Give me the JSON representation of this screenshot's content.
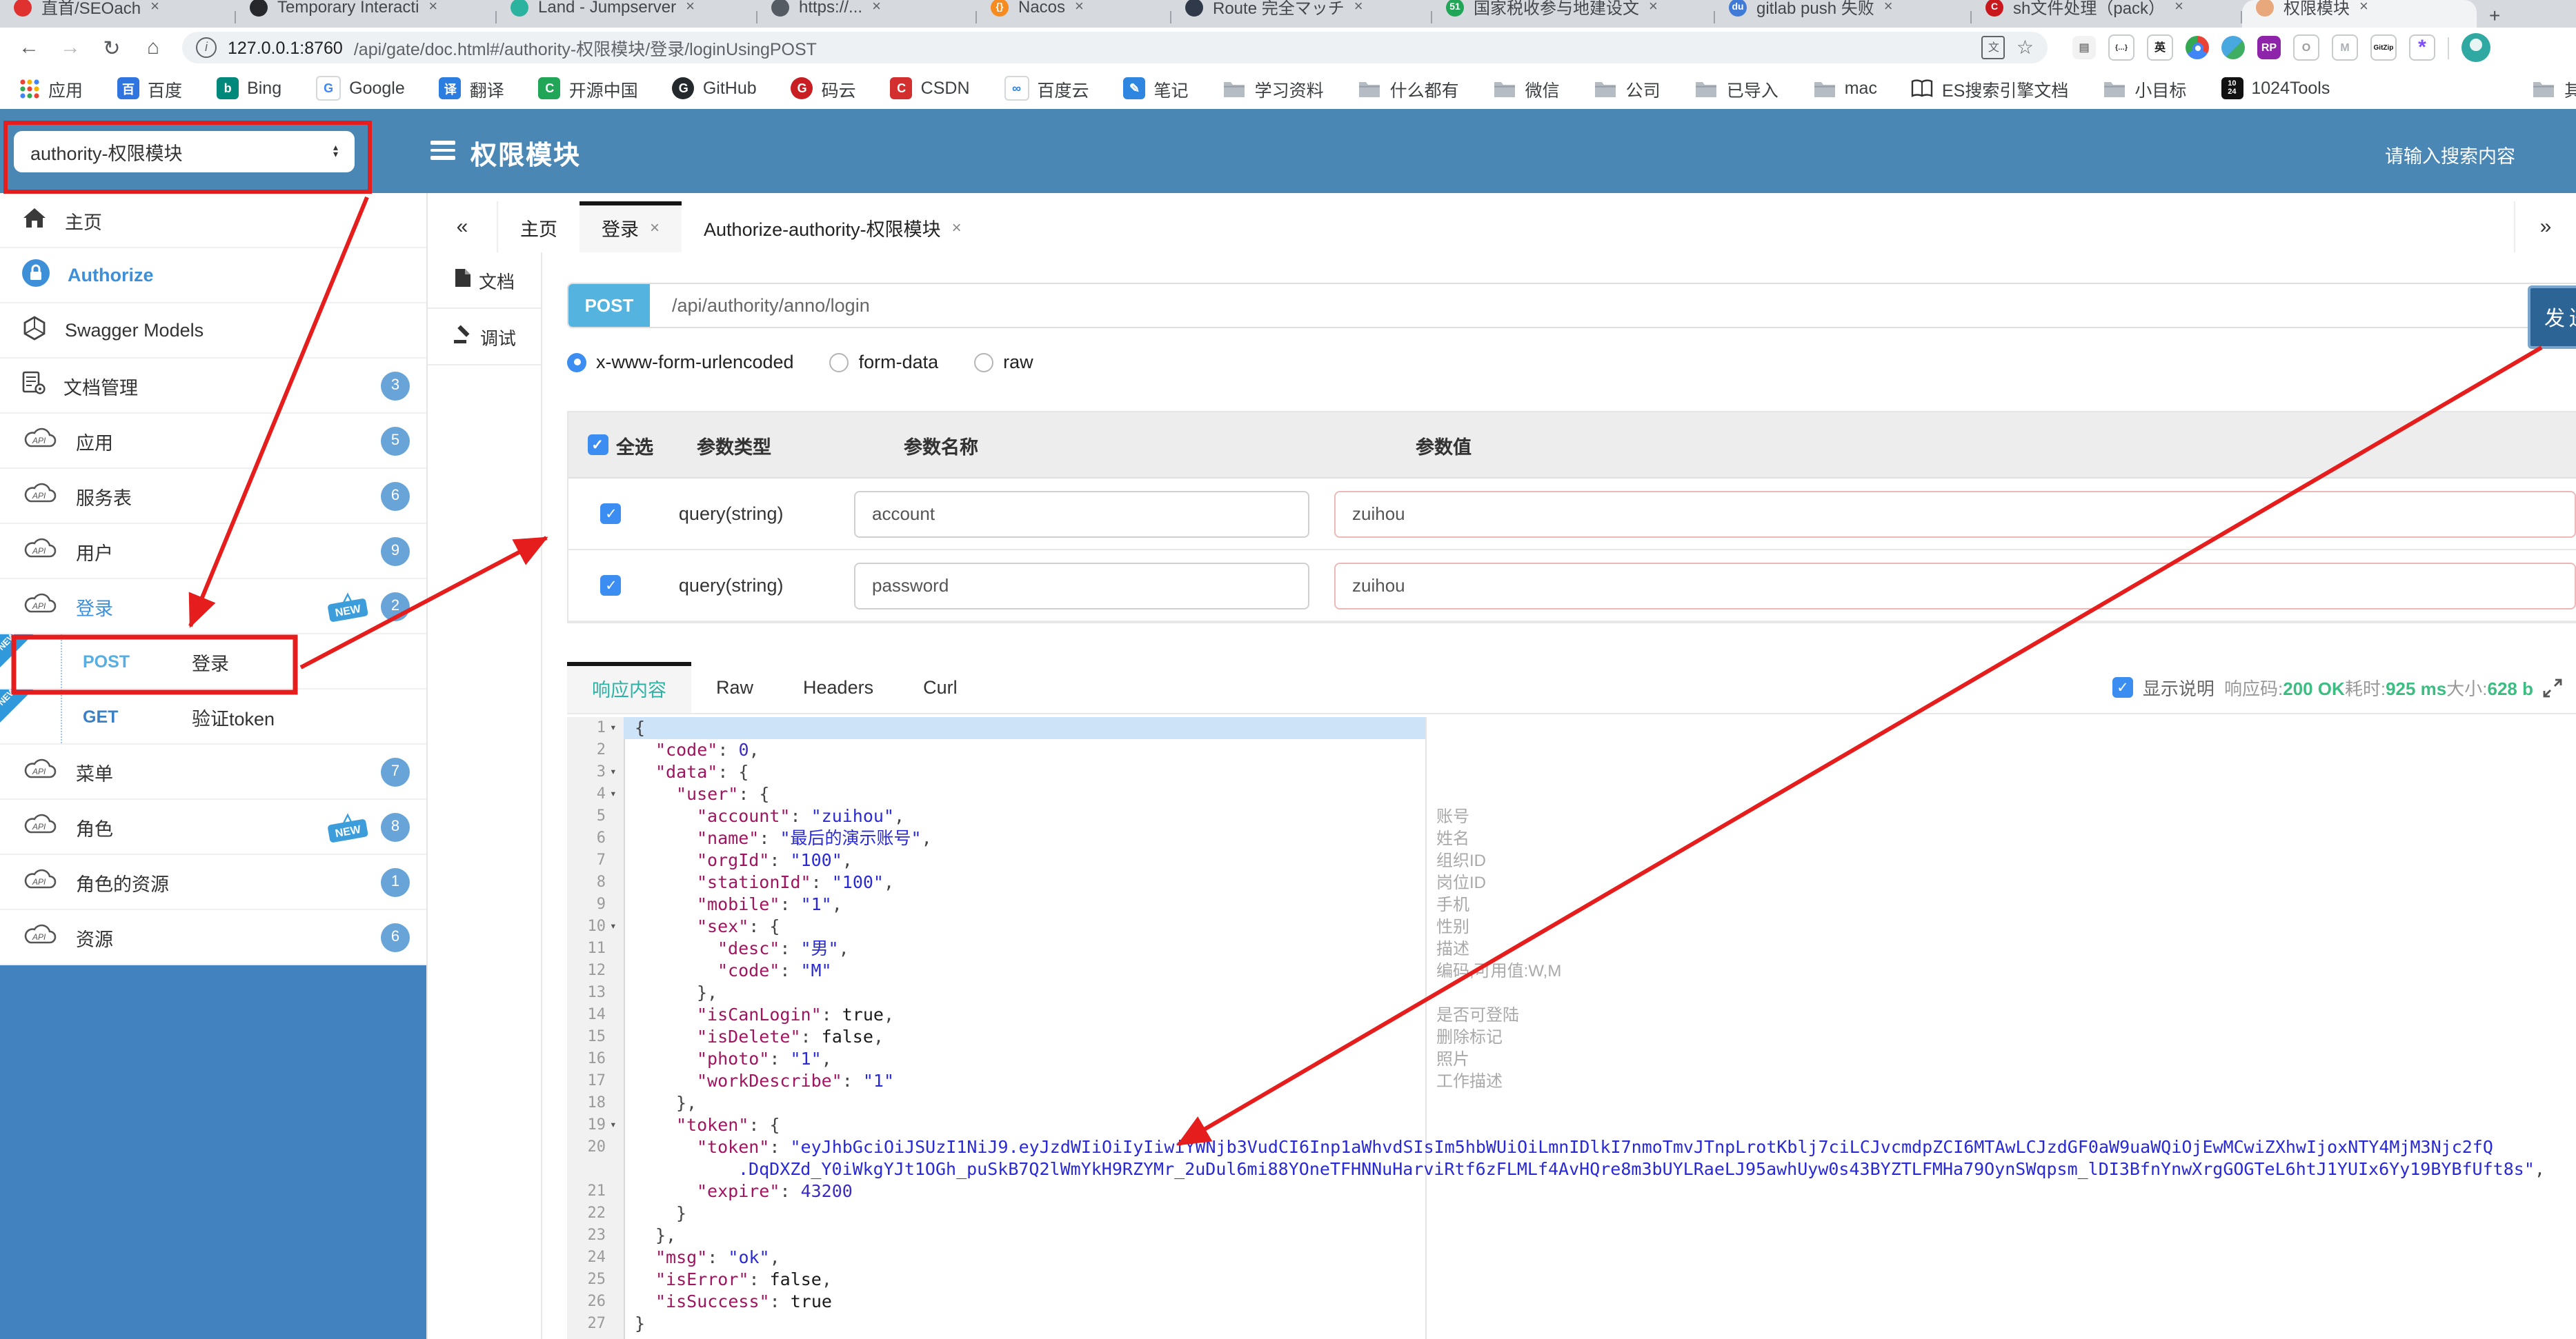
{
  "browser": {
    "tabs": [
      {
        "title": "直首/SEOach",
        "color": "#e03131",
        "glyph": "",
        "w": 150
      },
      {
        "title": "Temporary Interacti",
        "color": "#26282b",
        "glyph": "",
        "w": 168
      },
      {
        "title": "Land - Jumpserver",
        "color": "#2bb3a0",
        "glyph": "",
        "w": 168
      },
      {
        "title": "https://...",
        "color": "#555b63",
        "glyph": "",
        "w": 138
      },
      {
        "title": "Nacos",
        "color": "#f68b1f",
        "glyph": "{}",
        "w": 120
      },
      {
        "title": "Route 完全マッチ",
        "color": "#30394a",
        "glyph": "",
        "w": 168
      },
      {
        "title": "国家税收参与地建设文",
        "color": "#21a556",
        "glyph": "51",
        "w": 184
      },
      {
        "title": "gitlab push 失败",
        "color": "#3f7ad6",
        "glyph": "du",
        "w": 165
      },
      {
        "title": "sh文件处理（pack）",
        "color": "#c9171e",
        "glyph": "C",
        "w": 175
      },
      {
        "title": "权限模块",
        "color": "#e8a87c",
        "glyph": "",
        "w": 150,
        "active": true
      }
    ],
    "new_tab": "+",
    "close_glyph": "×",
    "nav": {
      "back": "←",
      "forward": "→",
      "reload": "↻",
      "home": "⌂"
    },
    "url": {
      "host": "127.0.0.1:8760",
      "path": "/api/gate/doc.html#/authority-权限模块/登录/loginUsingPOST",
      "info": "i"
    },
    "translate_glyph": "文",
    "star_glyph": "☆",
    "extensions": [
      {
        "name": "reader-icon",
        "glyph": "▤",
        "bg": "#f2f2f2",
        "fg": "#808080"
      },
      {
        "name": "json-viewer-icon",
        "glyph": "{…}",
        "bg": "#ffffff",
        "fg": "#222222"
      },
      {
        "name": "translate-en-icon",
        "glyph": "英",
        "bg": "#ffffff",
        "fg": "#222222"
      },
      {
        "name": "chrome-icon",
        "glyph": "",
        "bg": "chrome",
        "fg": ""
      },
      {
        "name": "globe-icon",
        "glyph": "",
        "bg": "globe",
        "fg": ""
      },
      {
        "name": "rp-icon",
        "glyph": "RP",
        "bg": "#8e24aa",
        "fg": "#ffffff"
      },
      {
        "name": "ring-icon",
        "glyph": "O",
        "bg": "#ffffff",
        "fg": "#9e9e9e"
      },
      {
        "name": "m-chevron-icon",
        "glyph": "M",
        "bg": "#ffffff",
        "fg": "#aab0b6"
      },
      {
        "name": "gitzip-icon",
        "glyph": "GitZip",
        "bg": "#ffffff",
        "fg": "#111111"
      },
      {
        "name": "asterisk-icon",
        "glyph": "*",
        "bg": "#ffffff",
        "fg": "#7c4dff"
      }
    ],
    "bookmarks": [
      {
        "label": "应用",
        "icon": "grid"
      },
      {
        "label": "百度",
        "icon": "site",
        "bg": "#3074e0",
        "glyph": "百",
        "fg": "#ffffff"
      },
      {
        "label": "Bing",
        "icon": "site",
        "bg": "#00897b",
        "glyph": "b",
        "fg": "#ffffff"
      },
      {
        "label": "Google",
        "icon": "site",
        "bg": "#ffffff",
        "glyph": "G",
        "fg": "#4285f4"
      },
      {
        "label": "翻译",
        "icon": "site",
        "bg": "#2b7de0",
        "glyph": "译",
        "fg": "#ffffff"
      },
      {
        "label": "开源中国",
        "icon": "site",
        "bg": "#21a556",
        "glyph": "C",
        "fg": "#ffffff"
      },
      {
        "label": "GitHub",
        "icon": "site",
        "bg": "#24292e",
        "glyph": "G",
        "fg": "#ffffff"
      },
      {
        "label": "码云",
        "icon": "site",
        "bg": "#c71d23",
        "glyph": "G",
        "fg": "#ffffff"
      },
      {
        "label": "CSDN",
        "icon": "site",
        "bg": "#d32f2f",
        "glyph": "C",
        "fg": "#ffffff"
      },
      {
        "label": "百度云",
        "icon": "site",
        "bg": "#ffffff",
        "glyph": "∞",
        "fg": "#2b7de0"
      },
      {
        "label": "笔记",
        "icon": "site",
        "bg": "#2f86e0",
        "glyph": "✎",
        "fg": "#ffffff"
      },
      {
        "label": "学习资料",
        "icon": "folder"
      },
      {
        "label": "什么都有",
        "icon": "folder"
      },
      {
        "label": "微信",
        "icon": "folder"
      },
      {
        "label": "公司",
        "icon": "folder"
      },
      {
        "label": "已导入",
        "icon": "folder"
      },
      {
        "label": "mac",
        "icon": "folder"
      },
      {
        "label": "ES搜索引擎文档",
        "icon": "book"
      },
      {
        "label": "小目标",
        "icon": "folder"
      },
      {
        "label": "1024Tools",
        "icon": "ten24"
      }
    ],
    "bookmarks_overflow": {
      "label": "其"
    }
  },
  "header": {
    "project_select": "authority-权限模块",
    "title": "权限模块",
    "search_placeholder": "请输入搜索内容"
  },
  "sidebar": {
    "items": [
      {
        "label": "主页",
        "icon": "home"
      },
      {
        "label": "Authorize",
        "icon": "lock",
        "accent": true
      },
      {
        "label": "Swagger Models",
        "icon": "hexagon"
      },
      {
        "label": "文档管理",
        "icon": "docs",
        "badge": "3"
      },
      {
        "label": "应用",
        "icon": "cloud",
        "badge": "5"
      },
      {
        "label": "服务表",
        "icon": "cloud",
        "badge": "6"
      },
      {
        "label": "用户",
        "icon": "cloud",
        "badge": "9"
      },
      {
        "label": "登录",
        "icon": "cloud",
        "badge": "2",
        "isNew": true,
        "selected": true
      },
      {
        "type": "op",
        "method": "POST",
        "method_color": "#56aee2",
        "label": "登录",
        "ribbon": "NEW"
      },
      {
        "type": "op",
        "method": "GET",
        "method_color": "#3b7fc7",
        "label": "验证token",
        "ribbon": "NEW"
      },
      {
        "label": "菜单",
        "icon": "cloud",
        "badge": "7"
      },
      {
        "label": "角色",
        "icon": "cloud",
        "badge": "8",
        "isNew": true
      },
      {
        "label": "角色的资源",
        "icon": "cloud",
        "badge": "1"
      },
      {
        "label": "资源",
        "icon": "cloud",
        "badge": "6"
      }
    ]
  },
  "app_tabs": {
    "collapse": "«",
    "expand": "»",
    "items": [
      {
        "label": "主页"
      },
      {
        "label": "登录",
        "closable": true,
        "active": true
      },
      {
        "label": "Authorize-authority-权限模块",
        "closable": true
      }
    ]
  },
  "doc_tabs": [
    {
      "label": "文档",
      "icon": "doc"
    },
    {
      "label": "调试",
      "icon": "debug",
      "active": true
    }
  ],
  "endpoint": {
    "method": "POST",
    "path": "/api/authority/anno/login",
    "send": "发送"
  },
  "body_types": [
    {
      "label": "x-www-form-urlencoded",
      "selected": true
    },
    {
      "label": "form-data"
    },
    {
      "label": "raw"
    }
  ],
  "params": {
    "select_all": "全选",
    "headers": [
      "参数类型",
      "参数名称",
      "参数值"
    ],
    "rows": [
      {
        "checked": true,
        "type": "query(string)",
        "name": "account",
        "value": "zuihou"
      },
      {
        "checked": true,
        "type": "query(string)",
        "name": "password",
        "value": "zuihou"
      }
    ]
  },
  "response": {
    "tabs": [
      "响应内容",
      "Raw",
      "Headers",
      "Curl"
    ],
    "active_index": 0,
    "show_desc": "显示说明",
    "status": [
      {
        "label": "响应码:",
        "value": "200 OK"
      },
      {
        "label": "耗时:",
        "value": "925 ms"
      },
      {
        "label": "大小:",
        "value": "628 b"
      }
    ]
  },
  "editor": {
    "fold_glyph": "▾"
  },
  "check_glyph": "✓",
  "annotation": {
    "color": "#e51d1d"
  },
  "json": {
    "lines": [
      {
        "n": "1",
        "fold": true,
        "ind": 0,
        "hl": true,
        "toks": [
          [
            "p",
            "{"
          ]
        ]
      },
      {
        "n": "2",
        "ind": 2,
        "toks": [
          [
            "k",
            "\"code\""
          ],
          [
            "p",
            ": "
          ],
          [
            "d",
            "0"
          ],
          [
            "p",
            ","
          ]
        ]
      },
      {
        "n": "3",
        "fold": true,
        "ind": 2,
        "toks": [
          [
            "k",
            "\"data\""
          ],
          [
            "p",
            ": {"
          ]
        ]
      },
      {
        "n": "4",
        "fold": true,
        "ind": 4,
        "toks": [
          [
            "k",
            "\"user\""
          ],
          [
            "p",
            ": {"
          ]
        ]
      },
      {
        "n": "5",
        "ind": 6,
        "note": "账号",
        "toks": [
          [
            "k",
            "\"account\""
          ],
          [
            "p",
            ": "
          ],
          [
            "s",
            "\"zuihou\""
          ],
          [
            "p",
            ","
          ]
        ]
      },
      {
        "n": "6",
        "ind": 6,
        "note": "姓名",
        "toks": [
          [
            "k",
            "\"name\""
          ],
          [
            "p",
            ": "
          ],
          [
            "s",
            "\"最后的演示账号\""
          ],
          [
            "p",
            ","
          ]
        ]
      },
      {
        "n": "7",
        "ind": 6,
        "note": "组织ID",
        "toks": [
          [
            "k",
            "\"orgId\""
          ],
          [
            "p",
            ": "
          ],
          [
            "s",
            "\"100\""
          ],
          [
            "p",
            ","
          ]
        ]
      },
      {
        "n": "8",
        "ind": 6,
        "note": "岗位ID",
        "toks": [
          [
            "k",
            "\"stationId\""
          ],
          [
            "p",
            ": "
          ],
          [
            "s",
            "\"100\""
          ],
          [
            "p",
            ","
          ]
        ]
      },
      {
        "n": "9",
        "ind": 6,
        "note": "手机",
        "toks": [
          [
            "k",
            "\"mobile\""
          ],
          [
            "p",
            ": "
          ],
          [
            "s",
            "\"1\""
          ],
          [
            "p",
            ","
          ]
        ]
      },
      {
        "n": "10",
        "fold": true,
        "ind": 6,
        "note": "性别",
        "toks": [
          [
            "k",
            "\"sex\""
          ],
          [
            "p",
            ": {"
          ]
        ]
      },
      {
        "n": "11",
        "ind": 8,
        "note": "描述",
        "toks": [
          [
            "k",
            "\"desc\""
          ],
          [
            "p",
            ": "
          ],
          [
            "s",
            "\"男\""
          ],
          [
            "p",
            ","
          ]
        ]
      },
      {
        "n": "12",
        "ind": 8,
        "note": "编码,可用值:W,M",
        "toks": [
          [
            "k",
            "\"code\""
          ],
          [
            "p",
            ": "
          ],
          [
            "s",
            "\"M\""
          ]
        ]
      },
      {
        "n": "13",
        "ind": 6,
        "toks": [
          [
            "p",
            "},"
          ]
        ]
      },
      {
        "n": "14",
        "ind": 6,
        "note": "是否可登陆",
        "toks": [
          [
            "k",
            "\"isCanLogin\""
          ],
          [
            "p",
            ": "
          ],
          [
            "b",
            "true"
          ],
          [
            "p",
            ","
          ]
        ]
      },
      {
        "n": "15",
        "ind": 6,
        "note": "删除标记",
        "toks": [
          [
            "k",
            "\"isDelete\""
          ],
          [
            "p",
            ": "
          ],
          [
            "b",
            "false"
          ],
          [
            "p",
            ","
          ]
        ]
      },
      {
        "n": "16",
        "ind": 6,
        "note": "照片",
        "toks": [
          [
            "k",
            "\"photo\""
          ],
          [
            "p",
            ": "
          ],
          [
            "s",
            "\"1\""
          ],
          [
            "p",
            ","
          ]
        ]
      },
      {
        "n": "17",
        "ind": 6,
        "note": "工作描述",
        "toks": [
          [
            "k",
            "\"workDescribe\""
          ],
          [
            "p",
            ": "
          ],
          [
            "s",
            "\"1\""
          ]
        ]
      },
      {
        "n": "18",
        "ind": 4,
        "toks": [
          [
            "p",
            "},"
          ]
        ]
      },
      {
        "n": "19",
        "fold": true,
        "ind": 4,
        "toks": [
          [
            "k",
            "\"token\""
          ],
          [
            "p",
            ": {"
          ]
        ]
      },
      {
        "n": "20",
        "ind": 6,
        "toks": [
          [
            "k",
            "\"token\""
          ],
          [
            "p",
            ": "
          ],
          [
            "s",
            "\"eyJhbGciOiJSUzI1NiJ9.eyJzdWIiOiIyIiwiYWNjb3VudCI6Inp1aWhvdSIsIm5hbWUiOiLmnIDlkI7nmoTmvJTnpLrotKblj7ciLCJvcmdpZCI6MTAwLCJzdGF0aW9uaWQiOjEwMCwiZXhwIjoxNTY4MjM3Njc2fQ"
          ]
        ]
      },
      {
        "n": "",
        "ind": 10,
        "toks": [
          [
            "s",
            ".DqDXZd_Y0iWkgYJt1OGh_puSkB7Q2lWmYkH9RZYMr_2uDul6mi88YOneTFHNNuHarviRtf6zFLMLf4AvHQre8m3bUYLRaeLJ95awhUyw0s43BYZTLFMHa79OynSWqpsm_lDI3BfnYnwXrgGOGTeL6htJ1YUIx6Yy19BYBfUft8s\""
          ],
          [
            "p",
            ","
          ]
        ]
      },
      {
        "n": "21",
        "ind": 6,
        "toks": [
          [
            "k",
            "\"expire\""
          ],
          [
            "p",
            ": "
          ],
          [
            "d",
            "43200"
          ]
        ]
      },
      {
        "n": "22",
        "ind": 4,
        "toks": [
          [
            "p",
            "}"
          ]
        ]
      },
      {
        "n": "23",
        "ind": 2,
        "toks": [
          [
            "p",
            "},"
          ]
        ]
      },
      {
        "n": "24",
        "ind": 2,
        "toks": [
          [
            "k",
            "\"msg\""
          ],
          [
            "p",
            ": "
          ],
          [
            "s",
            "\"ok\""
          ],
          [
            "p",
            ","
          ]
        ]
      },
      {
        "n": "25",
        "ind": 2,
        "toks": [
          [
            "k",
            "\"isError\""
          ],
          [
            "p",
            ": "
          ],
          [
            "b",
            "false"
          ],
          [
            "p",
            ","
          ]
        ]
      },
      {
        "n": "26",
        "ind": 2,
        "toks": [
          [
            "k",
            "\"isSuccess\""
          ],
          [
            "p",
            ": "
          ],
          [
            "b",
            "true"
          ]
        ]
      },
      {
        "n": "27",
        "ind": 0,
        "toks": [
          [
            "p",
            "}"
          ]
        ]
      }
    ]
  }
}
